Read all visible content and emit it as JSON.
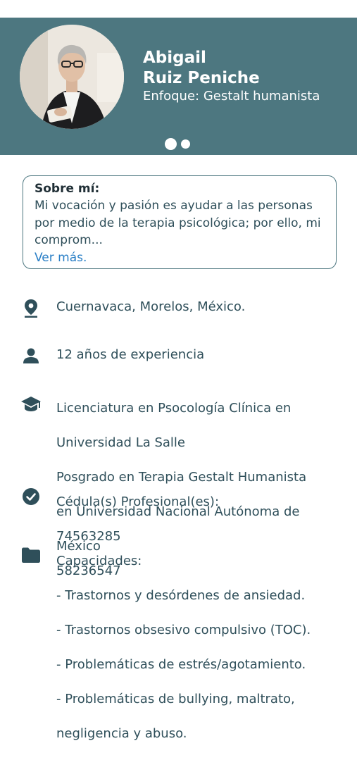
{
  "profile": {
    "name_line1": "Abigail",
    "name_line2": "Ruiz Peniche",
    "focus": "Enfoque: Gestalt humanista"
  },
  "carousel": {
    "count": 2,
    "active": 1
  },
  "about": {
    "title": "Sobre mí:",
    "text": "Mi vocación y pasión es ayudar a las personas por medio de la terapia psicológica; por ello, mi comprom...",
    "more": "Ver más."
  },
  "details": {
    "location": "Cuernavaca, Morelos, México.",
    "experience": "12 años de experiencia",
    "education": [
      "Licenciatura en Psocología Clínica en",
      "Universidad La Salle",
      "Posgrado en Terapia Gestalt Humanista",
      "en Universidad Nacional Autónoma de",
      "México"
    ],
    "license_title": "Cédula(s) Profesional(es):",
    "licenses": [
      "74563285",
      "58236547"
    ],
    "capabilities_title": "Capacidades:",
    "capabilities": [
      "- Trastornos y desórdenes de ansiedad.",
      "- Trastornos obsesivo compulsivo (TOC).",
      "- Problemáticas de estrés/agotamiento.",
      "- Problemáticas de bullying, maltrato,",
      "negligencia y abuso."
    ]
  },
  "colors": {
    "header": "#4d7780",
    "link": "#2a7fc6",
    "text": "#2f4f5a"
  },
  "icons": [
    "location-pin-icon",
    "person-icon",
    "graduation-cap-icon",
    "check-circle-icon",
    "folder-icon"
  ]
}
